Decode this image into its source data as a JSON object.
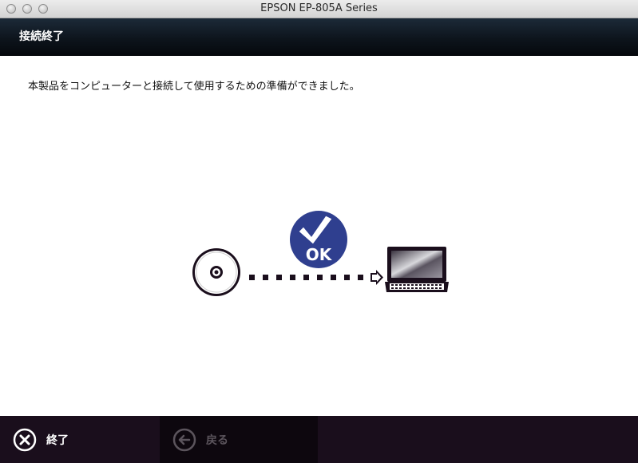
{
  "window": {
    "title": "EPSON EP-805A Series"
  },
  "header": {
    "title": "接続終了"
  },
  "main": {
    "message": "本製品をコンピューターと接続して使用するための準備ができました。",
    "status_badge": "OK"
  },
  "footer": {
    "finish_label": "終了",
    "back_label": "戻る"
  },
  "colors": {
    "header_bg": "#0d141c",
    "footer_bg": "#1a0e1c",
    "badge_blue": "#2f3f8f",
    "disabled_text": "#5b545c"
  },
  "icons": {
    "disc": "disc-icon",
    "laptop": "laptop-icon",
    "check": "checkmark-icon",
    "finish": "close-circle-icon",
    "back": "arrow-left-circle-icon"
  }
}
